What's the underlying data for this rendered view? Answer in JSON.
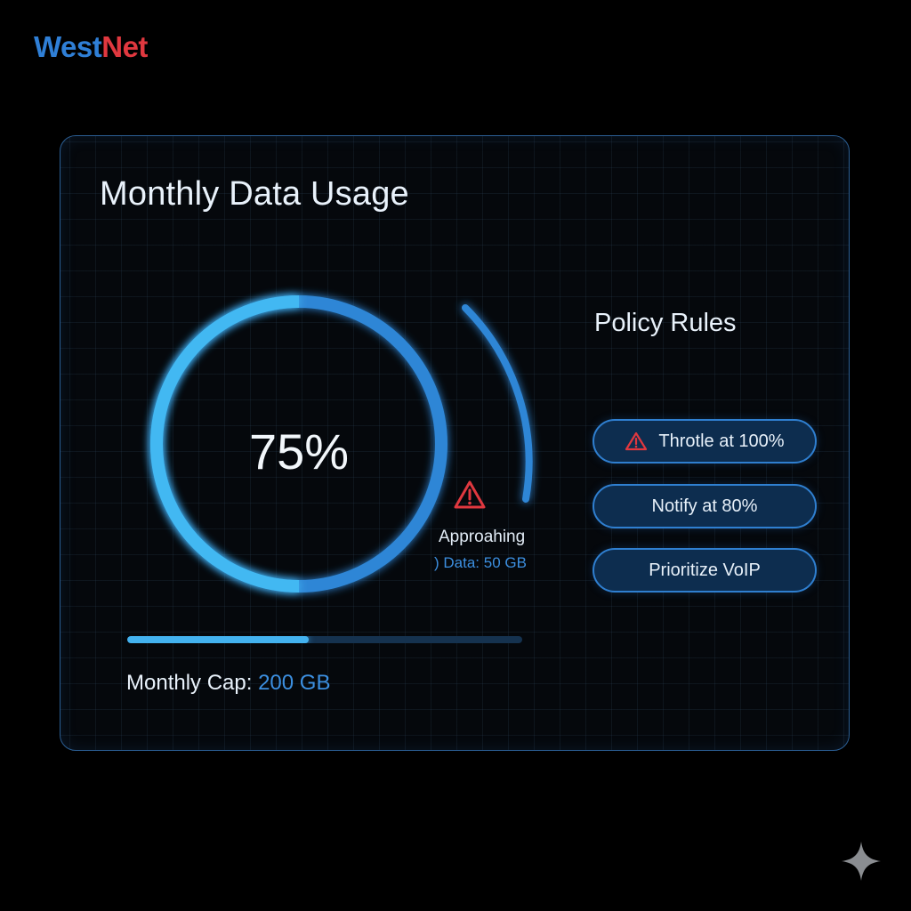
{
  "brand": {
    "west": "West",
    "net": "Net"
  },
  "panel": {
    "title": "Monthly Data Usage"
  },
  "usage": {
    "percent_label": "75%",
    "percent_value": 75,
    "warning_title": "Approahing",
    "warning_detail": ") Data: 50 GB"
  },
  "policy": {
    "title": "Policy Rules",
    "rules": [
      {
        "label": "Throtle at 100%",
        "icon": "warning-icon"
      },
      {
        "label": "Notify at 80%"
      },
      {
        "label": "Prioritize VoIP"
      }
    ]
  },
  "progress": {
    "fraction": 0.46
  },
  "cap": {
    "label": "Monthly Cap: ",
    "value": "200 GB"
  },
  "colors": {
    "brand_blue": "#2f7fd6",
    "brand_red": "#e0383f",
    "accent_cyan": "#43b2ef",
    "accent_blue": "#2f86d6",
    "warning_red": "#e0383f",
    "pill_fill": "#0d2d4f"
  }
}
